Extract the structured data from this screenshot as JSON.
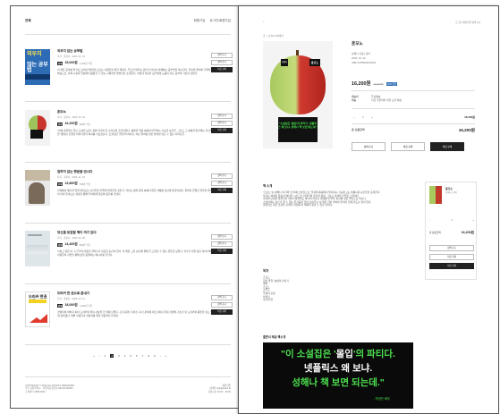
{
  "left": {
    "logo": "전체",
    "header_links": [
      "회원가입",
      "로그인/회원가입"
    ],
    "items": [
      {
        "title": "외우지 않는 공부법",
        "meta": "저자 · 출판사 · 2023. 01. 15",
        "badge": "판매",
        "price": "15,000원",
        "point": "1,500원 적립",
        "desc": "이 책은 공부를 잘 하고 싶지만 방법을 모르는 사람들을 위한 책이다. 무조건 외우는 공부가 아니라 이해하는 공부법을 제시한다. 학습의 원리와 기억의 구조를 바탕으로, 실제 시험과 일상에서 활용할 수 있는 구체적인 방법들을 소개한다. 학생과 직장인 모두에게 도움이 되는 공부의 기술을 담았다.",
        "cover_t1": "외우지",
        "cover_t2": "않는 공부법"
      },
      {
        "title": "훈모노",
        "meta": "저자 · 출판사 · 2023. 03. 20",
        "badge": "판매",
        "price": "16,200원",
        "point": "900원 적립",
        "desc": "\"이제 넷플릭스 말고 소설을 보자\" 정영 작가의 첫 소설집이 출간되었다. 평범한 일상 속에서 마주하는 기묘한 순간들, 그리고 그 속에서 발견하는 인간의 본질. 짧지만 강렬한 이야기들이 독자를 사로잡는다. 소설집은 '몰입'의 파티다, 라는 말처럼 한번 펼치면 멈출 수 없는 이야기들."
      },
      {
        "title": "원하지 않는 행운을 만나다",
        "meta": "저자 · 출판사 · 2022. 11. 02",
        "badge": "판매",
        "price": "13,800원",
        "point": "760원 적립",
        "desc": "인생에서 예기치 않게 찾아오는 사건들을 어떻게 받아들일 것인가. 저자는 삶의 굴곡 속에서 얻은 지혜를 담담하게 풀어낸다. 원하지 않았던 일들이 결국 행운이 되어 돌아오는 과정을 통해 우리에게 위로와 용기를 건넨다."
      },
      {
        "title": "당신을 응원할 책이 여기 있다",
        "meta": "저자 · 출판사 · 2023. 02. 08",
        "badge": "판매",
        "price": "14,400원",
        "point": "800원 적립",
        "desc": "지치고 힘든 날, 누군가의 따뜻한 한마디가 필요한 순간이 있다. 이 책은 그런 순간에 곁에 두고 읽을 수 있는 글들을 모았다. 작가가 직접 겪은 이야기와 주변 사람들의 사연을 통해 삶을 응원하는 메시지를 전한다."
      },
      {
        "title": "드러커 한 권으로 끝내기",
        "meta": "저자 · 출판사 · 2023. 04. 11",
        "badge": "판매",
        "price": "18,000원",
        "point": "1,000원 적립",
        "desc": "경영학의 아버지 피터 드러커의 핵심 사상을 한 권에 담았다. 조직 운영, 리더십, 자기 관리에 이르기까지 현대 경영의 기초가 된 드러커의 통찰을 쉽고 명확하게 정리했다. 바쁜 직장인과 경영자를 위한 실용적인 안내서.",
        "cover_t": "드러커 한권으로"
      }
    ],
    "btn_cart": "장바구니",
    "btn_buy": "바로구매",
    "pager": [
      "«",
      "‹",
      "1",
      "2",
      "3",
      "4",
      "5",
      "6",
      "7",
      "8",
      "9",
      "›",
      "»"
    ],
    "pager_current": "2",
    "footer_left": [
      "COPYRIGHT © 2023 ALL RIGHTS RESERVED",
      "주소 서울특별시 · 사업자등록번호 000-00-00000",
      "고객센터 1588-0000"
    ],
    "footer_right": [
      "회원가입",
      "이메일 help@book.kr",
      "운영시간 10:00 - 18:00"
    ]
  },
  "right": {
    "header_links": [
      "로그인",
      "회원가입",
      "장바구니"
    ],
    "breadcrumb": "홈 > 소설/시/에세이",
    "cover_quote": "\"소설집은 '몰입'의 파티다. 넷플릭스 왜 보냐. 성해나 책 보면 되는데.\"",
    "cover_tag1": "성해나",
    "cover_tag2": "훈모노",
    "title": "훈모노",
    "info_rows": [
      "성해나 지음 | 창비",
      "2025. 03. 20",
      "ISBN 9788936439521"
    ],
    "price": "16,200원",
    "price_old": "18,000원",
    "price_tag": "10% 할인",
    "delivery": [
      [
        "배송비",
        "무료배송"
      ],
      [
        "배송",
        "지금 주문하면 내일 도착 예정"
      ]
    ],
    "qty": [
      "−",
      "1",
      "+"
    ],
    "qty_price": "16,200원",
    "total_label": "총 상품금액",
    "total": "16,200원",
    "btns": [
      "장바구니",
      "바로구매",
      "바로구매"
    ],
    "intro_title": "책 소개",
    "intro": [
      "\"훈모노\"는 성해나 작가의 첫 번째 소설집으로, 일상의 틈새에서 벌어지는 기묘하고도 아름다운 순간들을 포착한다.",
      "작가는 섬세한 문장과 예리한 시선으로 현대인의 불안과 욕망, 그리고 관계의 균열을 그려낸다.",
      "각각의 단편은 독립적인 이야기이면서도 하나의 커다란 세계를 이루며, 독자를 깊은 몰입으로 이끈다.",
      "소설이라는 장르가 줄 수 있는 즐거움을 한껏 보여주는 이 책은 한번 펼치면 끝까지 읽게 만드는 힘이 있다.",
      "넷플릭스 대신 소설을 선택할 이유를 이 책에서 찾을 수 있을 것이다."
    ],
    "side": {
      "title": "훈모노",
      "sub": "성해나 | 창비",
      "qty": [
        "−",
        "1",
        "+"
      ],
      "total_label": "총 상품금액",
      "total": "16,200원",
      "btns": [
        "장바구니",
        "바로구매",
        "바로구매"
      ]
    },
    "toc_title": "목차",
    "toc": [
      "훈모노",
      "길티 클럽: 호랑이 만지기",
      "메탈",
      "혼모노",
      "스무드",
      "우호적 감정",
      "잉태기",
      "작가의 말"
    ],
    "recommend_title": "출판사 제공 책소개",
    "banner": {
      "l1a": "\"이 소설집은 '",
      "l1b": "몰입",
      "l1c": "'의 파티다.",
      "l2": "넷플릭스 왜 보냐.",
      "l3": "성해나 책 보면 되는데.\"",
      "by": "- 작정단 배우"
    }
  }
}
